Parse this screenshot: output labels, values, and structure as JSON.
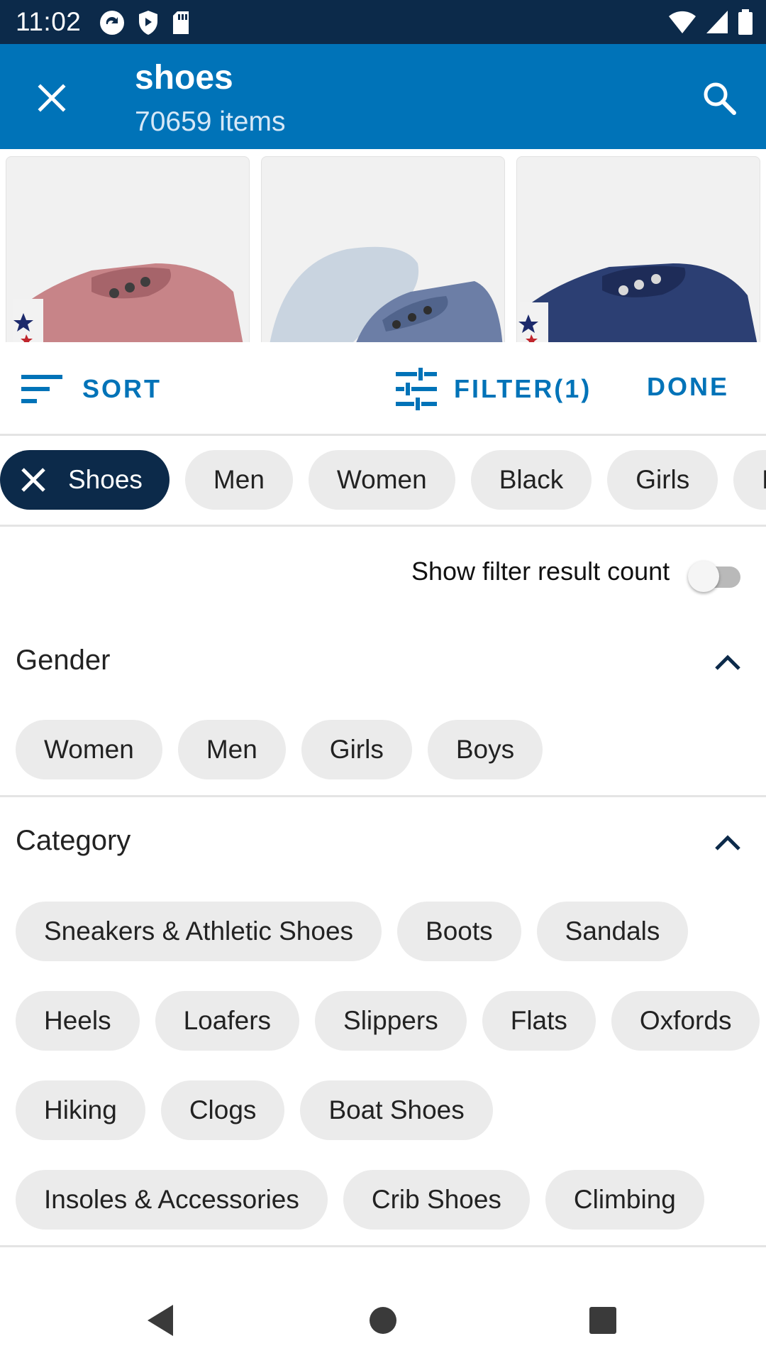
{
  "status_bar": {
    "time": "11:02"
  },
  "app_bar": {
    "title": "shoes",
    "subtitle": "70659 items"
  },
  "toolbar": {
    "sort_label": "SORT",
    "filter_label": "FILTER(1)",
    "done_label": "DONE"
  },
  "active_filters": {
    "selected_chip": "Shoes",
    "chips": [
      "Men",
      "Women",
      "Black",
      "Girls",
      "Boys"
    ]
  },
  "toggle": {
    "label": "Show filter result count",
    "on": false
  },
  "sections": {
    "gender": {
      "title": "Gender",
      "chips": [
        "Women",
        "Men",
        "Girls",
        "Boys"
      ]
    },
    "category": {
      "title": "Category",
      "rows": [
        [
          "Sneakers & Athletic Shoes",
          "Boots",
          "Sandals"
        ],
        [
          "Heels",
          "Loafers",
          "Slippers",
          "Flats",
          "Oxfords"
        ],
        [
          "Hiking",
          "Clogs",
          "Boat Shoes"
        ],
        [
          "Insoles & Accessories",
          "Crib Shoes",
          "Climbing"
        ]
      ]
    }
  },
  "colors": {
    "status_bar": "#0c2a4a",
    "app_bar": "#0073b8",
    "accent": "#0073b8",
    "selected_chip": "#0c2a4a",
    "chip": "#ebebeb"
  }
}
